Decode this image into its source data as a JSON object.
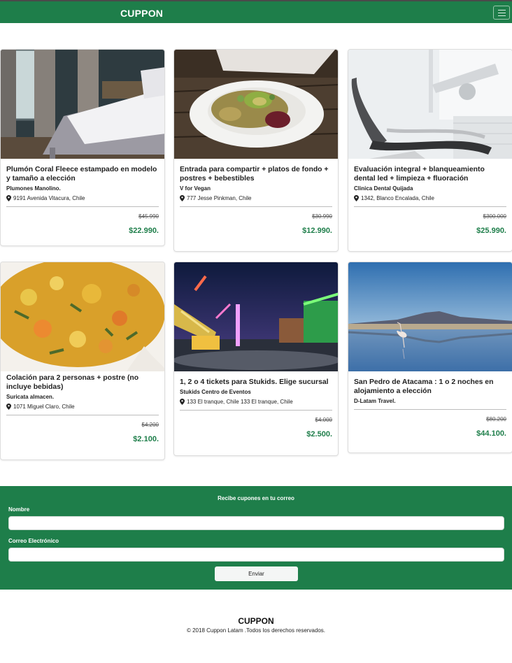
{
  "header": {
    "brand": "CUPPON",
    "menu_icon": "hamburger-icon"
  },
  "deals": [
    {
      "title": "Plumón Coral Fleece estampado en modelo y tamaño a elección",
      "merchant": "Plumones Manolino.",
      "address": "9191 Avenida Vitacura, Chile",
      "original_price": "$45.990",
      "price": "$22.990.",
      "image": "bedroom-photo"
    },
    {
      "title": "Entrada para compartir + platos de fondo + postres + bebestibles",
      "merchant": "V for Vegan",
      "address": "777 Jesse Pinkman, Chile",
      "original_price": "$30.990",
      "price": "$12.990.",
      "image": "salad-photo"
    },
    {
      "title": "Evaluación integral + blanqueamiento dental led + limpieza + fluoración",
      "merchant": "Clinica Dental Quijada",
      "address": "1342, Blanco Encalada, Chile",
      "original_price": "$300.000",
      "price": "$25.990.",
      "image": "dental-chair-photo"
    },
    {
      "title": "Colación para 2 personas + postre (no incluye bebidas)",
      "merchant": "Suricata almacen.",
      "address": "1071 Miguel Claro, Chile",
      "original_price": "$4.200",
      "price": "$2.100.",
      "image": "stew-photo"
    },
    {
      "title": "1, 2 o 4 tickets para Stukids. Elige sucursal",
      "merchant": "Stukids Centro de Eventos",
      "address": "133 El tranque, Chile 133 El tranque, Chile",
      "original_price": "$4.000",
      "price": "$2.500.",
      "image": "fair-photo"
    },
    {
      "title": "San Pedro de Atacama : 1 o 2 noches en alojamiento a elección",
      "merchant": "D-Latam Travel.",
      "address": "",
      "original_price": "$80.200",
      "price": "$44.100.",
      "image": "flamingo-lake-photo"
    }
  ],
  "newsletter": {
    "title": "Recibe cupones en tu correo",
    "name_label": "Nombre",
    "name_value": "",
    "email_label": "Correo Electrónico",
    "email_value": "",
    "submit_label": "Enviar"
  },
  "footer": {
    "brand": "CUPPON",
    "copyright": "© 2018 Cuppon Latam .Todos los derechos reservados."
  },
  "colors": {
    "brand_green": "#1e7e4a",
    "price_green": "#1e7e4a"
  }
}
